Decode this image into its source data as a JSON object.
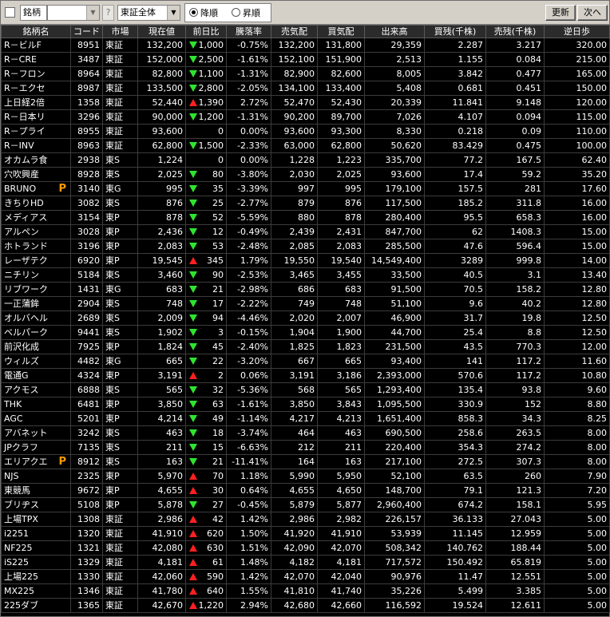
{
  "toolbar": {
    "field_label": "銘柄",
    "code_value": "",
    "help_label": "?",
    "market_select": "東証全体",
    "sort_desc": "降順",
    "sort_asc": "昇順",
    "refresh_label": "更新",
    "next_label": "次へ"
  },
  "columns": [
    "銘柄名",
    "コード",
    "市場",
    "現在値",
    "前日比",
    "騰落率",
    "売気配",
    "買気配",
    "出来高",
    "買残(千株)",
    "売残(千株)",
    "逆日歩"
  ],
  "colors": {
    "up": "#ff2020",
    "down": "#2ee52e",
    "unchanged": "#ffd400",
    "badge": "#ff9a00"
  },
  "rows": [
    {
      "name": "R－ビルF",
      "code": "8951",
      "market": "東証",
      "price": "132,200",
      "dir": "down",
      "change": "1,000",
      "pct": "-0.75%",
      "ask": "132,200",
      "bid": "131,800",
      "volume": "29,359",
      "buy": "2.287",
      "sell": "3.217",
      "rev": "320.00",
      "badge": ""
    },
    {
      "name": "R－CRE",
      "code": "3487",
      "market": "東証",
      "price": "152,000",
      "dir": "down",
      "change": "2,500",
      "pct": "-1.61%",
      "ask": "152,100",
      "bid": "151,900",
      "volume": "2,513",
      "buy": "1.155",
      "sell": "0.084",
      "rev": "215.00",
      "badge": ""
    },
    {
      "name": "R－フロン",
      "code": "8964",
      "market": "東証",
      "price": "82,800",
      "dir": "down",
      "change": "1,100",
      "pct": "-1.31%",
      "ask": "82,900",
      "bid": "82,600",
      "volume": "8,005",
      "buy": "3.842",
      "sell": "0.477",
      "rev": "165.00",
      "badge": ""
    },
    {
      "name": "R－エクセ",
      "code": "8987",
      "market": "東証",
      "price": "133,500",
      "dir": "down",
      "change": "2,800",
      "pct": "-2.05%",
      "ask": "134,100",
      "bid": "133,400",
      "volume": "5,408",
      "buy": "0.681",
      "sell": "0.451",
      "rev": "150.00",
      "badge": ""
    },
    {
      "name": "上日経2倍",
      "code": "1358",
      "market": "東証",
      "price": "52,440",
      "dir": "up",
      "change": "1,390",
      "pct": "2.72%",
      "ask": "52,470",
      "bid": "52,430",
      "volume": "20,339",
      "buy": "11.841",
      "sell": "9.148",
      "rev": "120.00",
      "badge": ""
    },
    {
      "name": "R－日本リ",
      "code": "3296",
      "market": "東証",
      "price": "90,000",
      "dir": "down",
      "change": "1,200",
      "pct": "-1.31%",
      "ask": "90,200",
      "bid": "89,700",
      "volume": "7,026",
      "buy": "4.107",
      "sell": "0.094",
      "rev": "115.00",
      "badge": ""
    },
    {
      "name": "R－プライ",
      "code": "8955",
      "market": "東証",
      "price": "93,600",
      "dir": "none",
      "change": "0",
      "pct": "0.00%",
      "ask": "93,600",
      "bid": "93,300",
      "volume": "8,330",
      "buy": "0.218",
      "sell": "0.09",
      "rev": "110.00",
      "badge": ""
    },
    {
      "name": "R－INV",
      "code": "8963",
      "market": "東証",
      "price": "62,800",
      "dir": "down",
      "change": "1,500",
      "pct": "-2.33%",
      "ask": "63,000",
      "bid": "62,800",
      "volume": "50,620",
      "buy": "83.429",
      "sell": "0.475",
      "rev": "100.00",
      "badge": ""
    },
    {
      "name": "オカムラ食",
      "code": "2938",
      "market": "東S",
      "price": "1,224",
      "dir": "none",
      "change": "0",
      "pct": "0.00%",
      "ask": "1,228",
      "bid": "1,223",
      "volume": "335,700",
      "buy": "77.2",
      "sell": "167.5",
      "rev": "62.40",
      "badge": ""
    },
    {
      "name": "穴吹興産",
      "code": "8928",
      "market": "東S",
      "price": "2,025",
      "dir": "down",
      "change": "80",
      "pct": "-3.80%",
      "ask": "2,030",
      "bid": "2,025",
      "volume": "93,600",
      "buy": "17.4",
      "sell": "59.2",
      "rev": "35.20",
      "badge": ""
    },
    {
      "name": "BRUNO",
      "code": "3140",
      "market": "東G",
      "price": "995",
      "dir": "down",
      "change": "35",
      "pct": "-3.39%",
      "ask": "997",
      "bid": "995",
      "volume": "179,100",
      "buy": "157.5",
      "sell": "281",
      "rev": "17.60",
      "badge": "P"
    },
    {
      "name": "きちりHD",
      "code": "3082",
      "market": "東S",
      "price": "876",
      "dir": "down",
      "change": "25",
      "pct": "-2.77%",
      "ask": "879",
      "bid": "876",
      "volume": "117,500",
      "buy": "185.2",
      "sell": "311.8",
      "rev": "16.00",
      "badge": ""
    },
    {
      "name": "メディアス",
      "code": "3154",
      "market": "東P",
      "price": "878",
      "dir": "down",
      "change": "52",
      "pct": "-5.59%",
      "ask": "880",
      "bid": "878",
      "volume": "280,400",
      "buy": "95.5",
      "sell": "658.3",
      "rev": "16.00",
      "badge": ""
    },
    {
      "name": "アルペン",
      "code": "3028",
      "market": "東P",
      "price": "2,436",
      "dir": "down",
      "change": "12",
      "pct": "-0.49%",
      "ask": "2,439",
      "bid": "2,431",
      "volume": "847,700",
      "buy": "62",
      "sell": "1408.3",
      "rev": "15.00",
      "badge": ""
    },
    {
      "name": "ホトランド",
      "code": "3196",
      "market": "東P",
      "price": "2,083",
      "dir": "down",
      "change": "53",
      "pct": "-2.48%",
      "ask": "2,085",
      "bid": "2,083",
      "volume": "285,500",
      "buy": "47.6",
      "sell": "596.4",
      "rev": "15.00",
      "badge": ""
    },
    {
      "name": "レーザテク",
      "code": "6920",
      "market": "東P",
      "price": "19,545",
      "dir": "up",
      "change": "345",
      "pct": "1.79%",
      "ask": "19,550",
      "bid": "19,540",
      "volume": "14,549,400",
      "buy": "3289",
      "sell": "999.8",
      "rev": "14.00",
      "badge": ""
    },
    {
      "name": "ニチリン",
      "code": "5184",
      "market": "東S",
      "price": "3,460",
      "dir": "down",
      "change": "90",
      "pct": "-2.53%",
      "ask": "3,465",
      "bid": "3,455",
      "volume": "33,500",
      "buy": "40.5",
      "sell": "3.1",
      "rev": "13.40",
      "badge": ""
    },
    {
      "name": "リブワーク",
      "code": "1431",
      "market": "東G",
      "price": "683",
      "dir": "down",
      "change": "21",
      "pct": "-2.98%",
      "ask": "686",
      "bid": "683",
      "volume": "91,500",
      "buy": "70.5",
      "sell": "158.2",
      "rev": "12.80",
      "badge": ""
    },
    {
      "name": "一正蒲鉾",
      "code": "2904",
      "market": "東S",
      "price": "748",
      "dir": "down",
      "change": "17",
      "pct": "-2.22%",
      "ask": "749",
      "bid": "748",
      "volume": "51,100",
      "buy": "9.6",
      "sell": "40.2",
      "rev": "12.80",
      "badge": ""
    },
    {
      "name": "オルバヘル",
      "code": "2689",
      "market": "東S",
      "price": "2,009",
      "dir": "down",
      "change": "94",
      "pct": "-4.46%",
      "ask": "2,020",
      "bid": "2,007",
      "volume": "46,900",
      "buy": "31.7",
      "sell": "19.8",
      "rev": "12.50",
      "badge": ""
    },
    {
      "name": "ベルパーク",
      "code": "9441",
      "market": "東S",
      "price": "1,902",
      "dir": "down",
      "change": "3",
      "pct": "-0.15%",
      "ask": "1,904",
      "bid": "1,900",
      "volume": "44,700",
      "buy": "25.4",
      "sell": "8.8",
      "rev": "12.50",
      "badge": ""
    },
    {
      "name": "前沢化成",
      "code": "7925",
      "market": "東P",
      "price": "1,824",
      "dir": "down",
      "change": "45",
      "pct": "-2.40%",
      "ask": "1,825",
      "bid": "1,823",
      "volume": "231,500",
      "buy": "43.5",
      "sell": "770.3",
      "rev": "12.00",
      "badge": ""
    },
    {
      "name": "ウィルズ",
      "code": "4482",
      "market": "東G",
      "price": "665",
      "dir": "down",
      "change": "22",
      "pct": "-3.20%",
      "ask": "667",
      "bid": "665",
      "volume": "93,400",
      "buy": "141",
      "sell": "117.2",
      "rev": "11.60",
      "badge": ""
    },
    {
      "name": "電通G",
      "code": "4324",
      "market": "東P",
      "price": "3,191",
      "dir": "up",
      "change": "2",
      "pct": "0.06%",
      "ask": "3,191",
      "bid": "3,186",
      "volume": "2,393,000",
      "buy": "570.6",
      "sell": "117.2",
      "rev": "10.80",
      "badge": ""
    },
    {
      "name": "アクモス",
      "code": "6888",
      "market": "東S",
      "price": "565",
      "dir": "down",
      "change": "32",
      "pct": "-5.36%",
      "ask": "568",
      "bid": "565",
      "volume": "1,293,400",
      "buy": "135.4",
      "sell": "93.8",
      "rev": "9.60",
      "badge": ""
    },
    {
      "name": "THK",
      "code": "6481",
      "market": "東P",
      "price": "3,850",
      "dir": "down",
      "change": "63",
      "pct": "-1.61%",
      "ask": "3,850",
      "bid": "3,843",
      "volume": "1,095,500",
      "buy": "330.9",
      "sell": "152",
      "rev": "8.80",
      "badge": ""
    },
    {
      "name": "AGC",
      "code": "5201",
      "market": "東P",
      "price": "4,214",
      "dir": "down",
      "change": "49",
      "pct": "-1.14%",
      "ask": "4,217",
      "bid": "4,213",
      "volume": "1,651,400",
      "buy": "858.3",
      "sell": "34.3",
      "rev": "8.25",
      "badge": ""
    },
    {
      "name": "アバネット",
      "code": "3242",
      "market": "東S",
      "price": "463",
      "dir": "down",
      "change": "18",
      "pct": "-3.74%",
      "ask": "464",
      "bid": "463",
      "volume": "690,500",
      "buy": "258.6",
      "sell": "263.5",
      "rev": "8.00",
      "badge": ""
    },
    {
      "name": "JPクラフ",
      "code": "7135",
      "market": "東S",
      "price": "211",
      "dir": "down",
      "change": "15",
      "pct": "-6.63%",
      "ask": "212",
      "bid": "211",
      "volume": "220,400",
      "buy": "354.3",
      "sell": "274.2",
      "rev": "8.00",
      "badge": ""
    },
    {
      "name": "エリアクエ",
      "code": "8912",
      "market": "東S",
      "price": "163",
      "dir": "down",
      "change": "21",
      "pct": "-11.41%",
      "ask": "164",
      "bid": "163",
      "volume": "217,100",
      "buy": "272.5",
      "sell": "307.3",
      "rev": "8.00",
      "badge": "P"
    },
    {
      "name": "NJS",
      "code": "2325",
      "market": "東P",
      "price": "5,970",
      "dir": "up",
      "change": "70",
      "pct": "1.18%",
      "ask": "5,990",
      "bid": "5,950",
      "volume": "52,100",
      "buy": "63.5",
      "sell": "260",
      "rev": "7.90",
      "badge": ""
    },
    {
      "name": "東競馬",
      "code": "9672",
      "market": "東P",
      "price": "4,655",
      "dir": "up",
      "change": "30",
      "pct": "0.64%",
      "ask": "4,655",
      "bid": "4,650",
      "volume": "148,700",
      "buy": "79.1",
      "sell": "121.3",
      "rev": "7.20",
      "badge": ""
    },
    {
      "name": "ブリヂス",
      "code": "5108",
      "market": "東P",
      "price": "5,878",
      "dir": "down",
      "change": "27",
      "pct": "-0.45%",
      "ask": "5,879",
      "bid": "5,877",
      "volume": "2,960,400",
      "buy": "674.2",
      "sell": "158.1",
      "rev": "5.95",
      "badge": ""
    },
    {
      "name": "上場TPX",
      "code": "1308",
      "market": "東証",
      "price": "2,986",
      "dir": "up",
      "change": "42",
      "pct": "1.42%",
      "ask": "2,986",
      "bid": "2,982",
      "volume": "226,157",
      "buy": "36.133",
      "sell": "27.043",
      "rev": "5.00",
      "badge": ""
    },
    {
      "name": "i2251",
      "code": "1320",
      "market": "東証",
      "price": "41,910",
      "dir": "up",
      "change": "620",
      "pct": "1.50%",
      "ask": "41,920",
      "bid": "41,910",
      "volume": "53,939",
      "buy": "11.145",
      "sell": "12.959",
      "rev": "5.00",
      "badge": ""
    },
    {
      "name": "NF225",
      "code": "1321",
      "market": "東証",
      "price": "42,080",
      "dir": "up",
      "change": "630",
      "pct": "1.51%",
      "ask": "42,090",
      "bid": "42,070",
      "volume": "508,342",
      "buy": "140.762",
      "sell": "188.44",
      "rev": "5.00",
      "badge": ""
    },
    {
      "name": "iS225",
      "code": "1329",
      "market": "東証",
      "price": "4,181",
      "dir": "up",
      "change": "61",
      "pct": "1.48%",
      "ask": "4,182",
      "bid": "4,181",
      "volume": "717,572",
      "buy": "150.492",
      "sell": "65.819",
      "rev": "5.00",
      "badge": ""
    },
    {
      "name": "上場225",
      "code": "1330",
      "market": "東証",
      "price": "42,060",
      "dir": "up",
      "change": "590",
      "pct": "1.42%",
      "ask": "42,070",
      "bid": "42,040",
      "volume": "90,976",
      "buy": "11.47",
      "sell": "12.551",
      "rev": "5.00",
      "badge": ""
    },
    {
      "name": "MX225",
      "code": "1346",
      "market": "東証",
      "price": "41,780",
      "dir": "up",
      "change": "640",
      "pct": "1.55%",
      "ask": "41,810",
      "bid": "41,740",
      "volume": "35,226",
      "buy": "5.499",
      "sell": "3.385",
      "rev": "5.00",
      "badge": ""
    },
    {
      "name": "225ダブ",
      "code": "1365",
      "market": "東証",
      "price": "42,670",
      "dir": "up",
      "change": "1,220",
      "pct": "2.94%",
      "ask": "42,680",
      "bid": "42,660",
      "volume": "116,592",
      "buy": "19.524",
      "sell": "12.611",
      "rev": "5.00",
      "badge": ""
    }
  ]
}
